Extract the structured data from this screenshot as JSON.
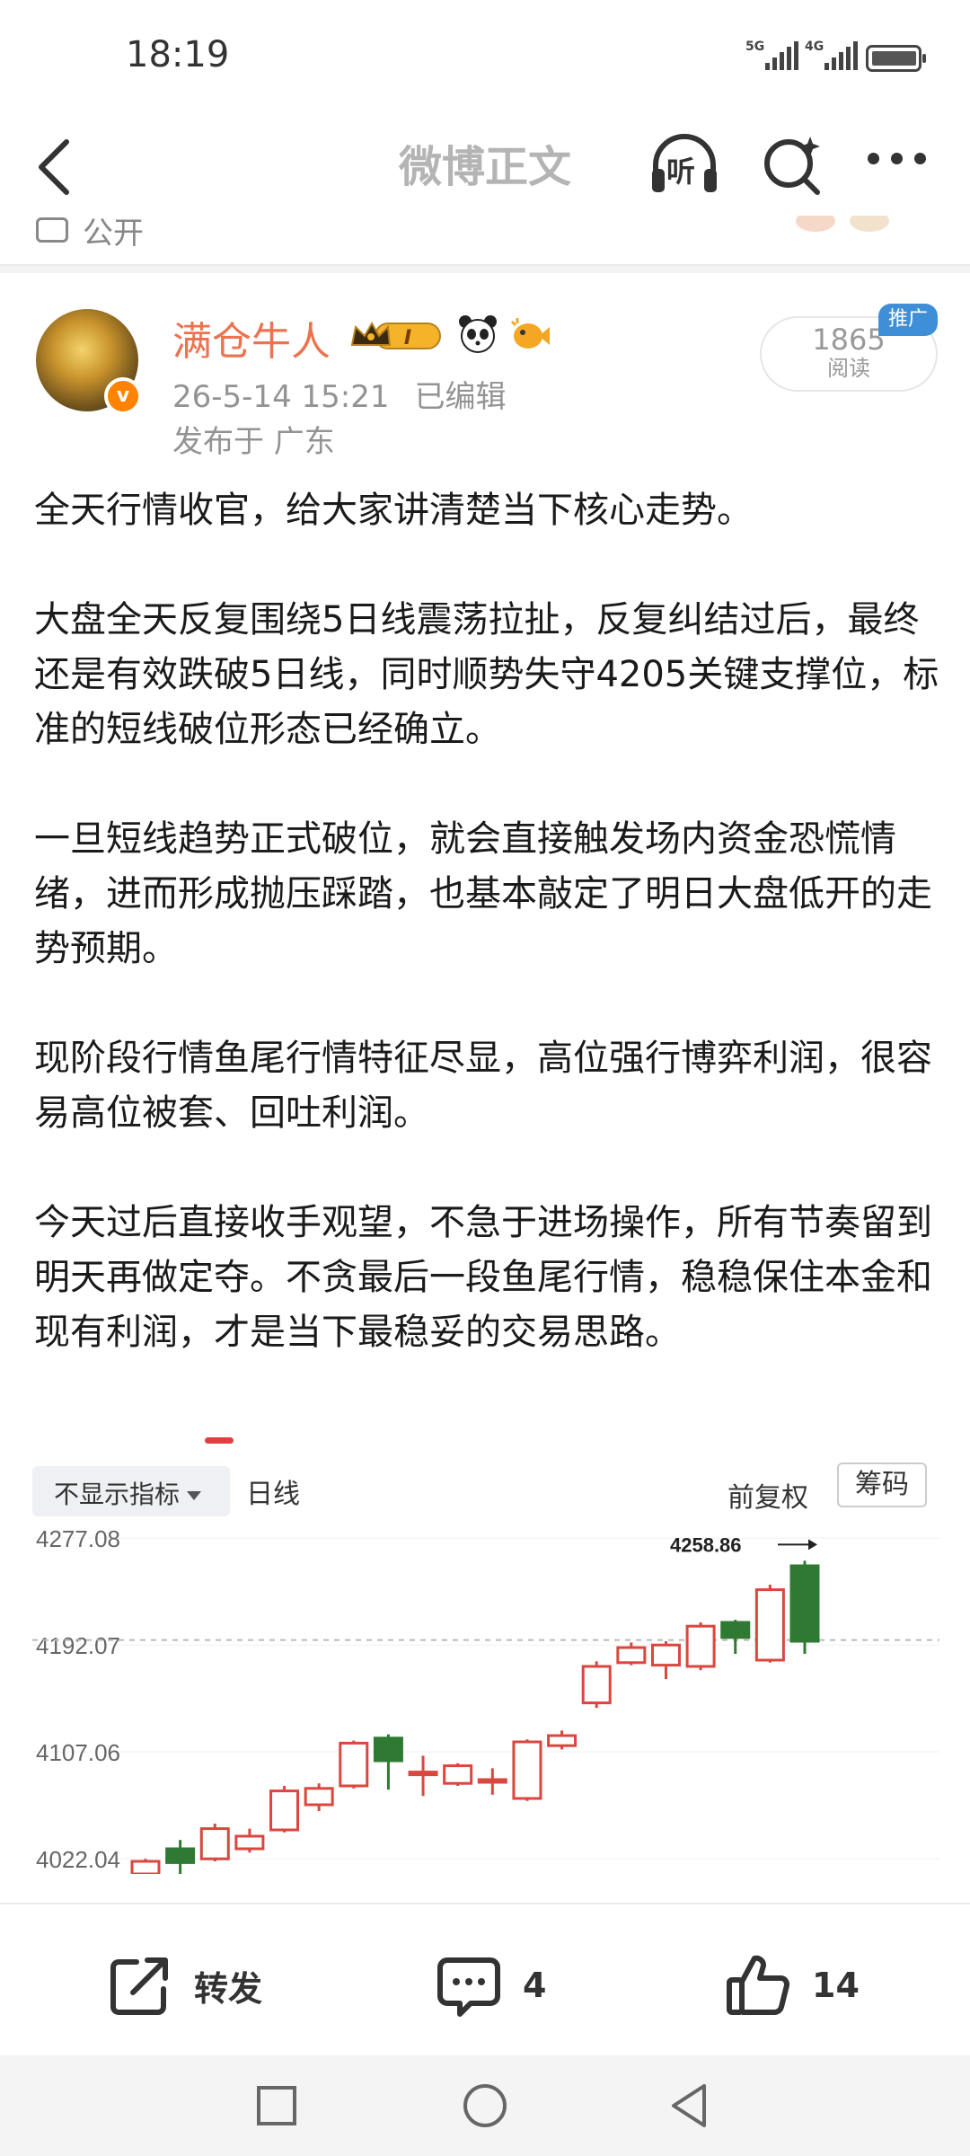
{
  "status_bar": {
    "time": "18:19",
    "signal1": "5G",
    "signal2": "4G",
    "battery_level": 0.9
  },
  "nav": {
    "title": "微博正文",
    "listen_label": "听"
  },
  "prev_post": {
    "visibility": "公开"
  },
  "post": {
    "author": "满仓牛人",
    "member_badge_level": "I",
    "timestamp": "26-5-14 15:21",
    "edited": "已编辑",
    "location": "发布于 广东",
    "reads": "1865",
    "reads_label": "阅读",
    "promo_tag": "推广",
    "paragraphs": [
      "全天行情收官，给大家讲清楚当下核心走势。",
      "大盘全天反复围绕5日线震荡拉扯，反复纠结过后，最终还是有效跌破5日线，同时顺势失守4205关键支撑位，标准的短线破位形态已经确立。",
      "一旦短线趋势正式破位，就会直接触发场内资金恐慌情绪，进而形成抛压踩踏，也基本敲定了明日大盘低开的走势预期。",
      "现阶段行情鱼尾行情特征尽显，高位强行博弈利润，很容易高位被套、回吐利润。",
      "今天过后直接收手观望，不急于进场操作，所有节奏留到明天再做定夺。不贪最后一段鱼尾行情，稳稳保住本金和现有利润，才是当下最稳妥的交易思路。"
    ]
  },
  "chart_image": {
    "indicator_button": "不显示指标",
    "period": "日线",
    "adjust": "前复权",
    "chips_button": "筹码"
  },
  "chart_data": {
    "type": "candlestick",
    "y_ticks": [
      "4277.08",
      "4192.07",
      "4107.06",
      "4022.04"
    ],
    "ylim": [
      4010,
      4290
    ],
    "high_label": "4258.86",
    "rising_color": "#d9473e",
    "falling_color": "#2f7a33",
    "candles": [
      {
        "o": 4010,
        "c": 4020,
        "h": 4022,
        "l": 4008
      },
      {
        "o": 4030,
        "c": 4019,
        "h": 4037,
        "l": 4010
      },
      {
        "o": 4022,
        "c": 4046,
        "h": 4050,
        "l": 4020
      },
      {
        "o": 4030,
        "c": 4040,
        "h": 4046,
        "l": 4027
      },
      {
        "o": 4045,
        "c": 4076,
        "h": 4080,
        "l": 4043
      },
      {
        "o": 4065,
        "c": 4078,
        "h": 4082,
        "l": 4060
      },
      {
        "o": 4080,
        "c": 4114,
        "h": 4116,
        "l": 4078
      },
      {
        "o": 4118,
        "c": 4100,
        "h": 4121,
        "l": 4077
      },
      {
        "o": 4090,
        "c": 4091,
        "h": 4104,
        "l": 4072
      },
      {
        "o": 4082,
        "c": 4096,
        "h": 4098,
        "l": 4080
      },
      {
        "o": 4083,
        "c": 4085,
        "h": 4094,
        "l": 4073
      },
      {
        "o": 4070,
        "c": 4115,
        "h": 4117,
        "l": 4068
      },
      {
        "o": 4112,
        "c": 4120,
        "h": 4124,
        "l": 4109
      },
      {
        "o": 4146,
        "c": 4175,
        "h": 4179,
        "l": 4142
      },
      {
        "o": 4178,
        "c": 4190,
        "h": 4194,
        "l": 4176
      },
      {
        "o": 4176,
        "c": 4192,
        "h": 4195,
        "l": 4165
      },
      {
        "o": 4175,
        "c": 4207,
        "h": 4210,
        "l": 4172
      },
      {
        "o": 4210,
        "c": 4198,
        "h": 4212,
        "l": 4185
      },
      {
        "o": 4180,
        "c": 4236,
        "h": 4240,
        "l": 4178
      },
      {
        "o": 4255,
        "c": 4195,
        "h": 4259,
        "l": 4185
      }
    ],
    "dashed_level": 4196
  },
  "actions": {
    "repost": "转发",
    "comments": "4",
    "likes": "14"
  },
  "colors": {
    "author": "#eb7350",
    "nav_title": "#b4b4b4",
    "meta": "#939393",
    "accent_blue": "#3f8fd6"
  }
}
